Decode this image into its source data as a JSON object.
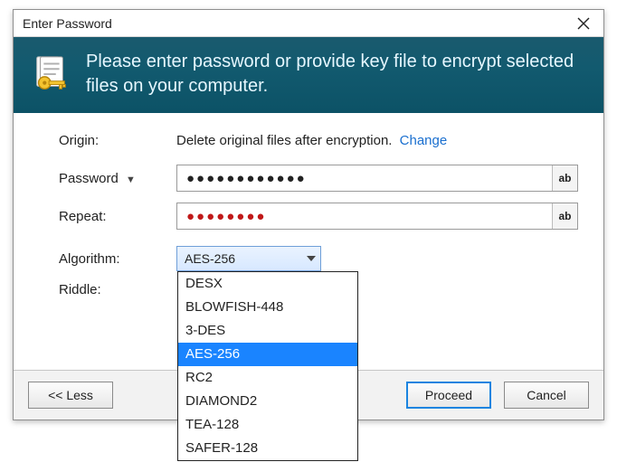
{
  "title": "Enter Password",
  "banner_text": "Please enter password or provide key file to encrypt selected files on your computer.",
  "labels": {
    "origin": "Origin:",
    "password": "Password",
    "repeat": "Repeat:",
    "algorithm": "Algorithm:",
    "riddle": "Riddle:"
  },
  "origin": {
    "text": "Delete original files after encryption.",
    "change": "Change"
  },
  "password": {
    "value_mask": "●●●●●●●●●●●●",
    "reveal_label": "ab"
  },
  "repeat": {
    "value_mask": "●●●●●●●●",
    "reveal_label": "ab"
  },
  "algorithm": {
    "selected": "AES-256",
    "options": [
      "DESX",
      "BLOWFISH-448",
      "3-DES",
      "AES-256",
      "RC2",
      "DIAMOND2",
      "TEA-128",
      "SAFER-128"
    ]
  },
  "buttons": {
    "less": "<< Less",
    "proceed": "Proceed",
    "cancel": "Cancel"
  }
}
